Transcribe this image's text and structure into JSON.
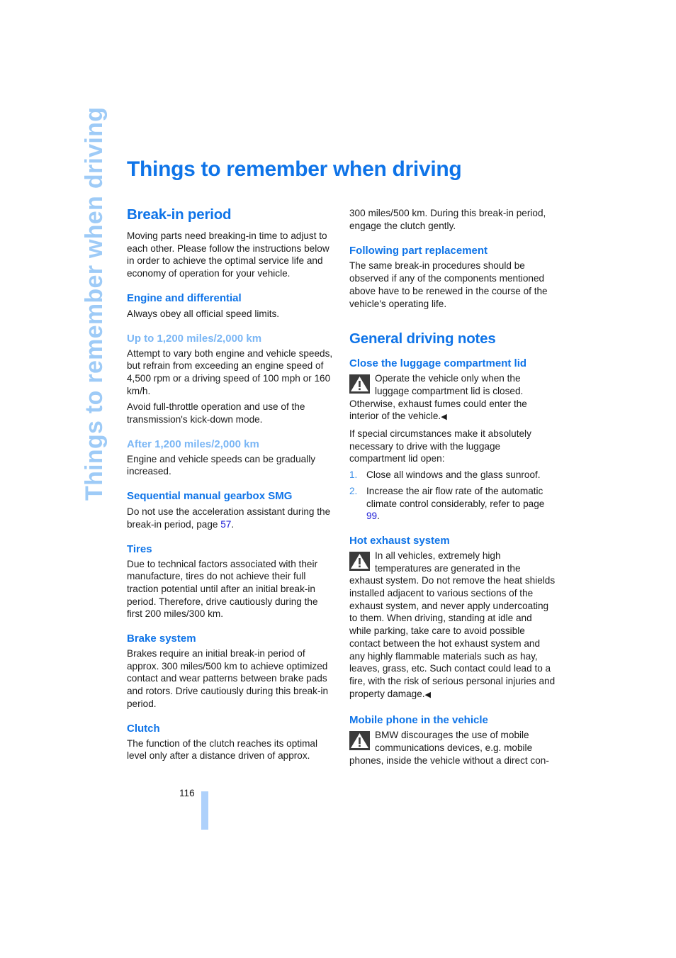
{
  "side_title": "Things to remember when driving",
  "page_title": "Things to remember when driving",
  "left_column": {
    "section_title": "Break-in period",
    "intro": "Moving parts need breaking-in time to adjust to each other. Please follow the instructions below in order to achieve the optimal service life and economy of operation for your vehicle.",
    "engine": {
      "heading": "Engine and differential",
      "text": "Always obey all official speed limits."
    },
    "up_to": {
      "heading": "Up to 1,200 miles/2,000 km",
      "text1": "Attempt to vary both engine and vehicle speeds, but refrain from exceeding an engine speed of 4,500 rpm or a driving speed of 100 mph or 160 km/h.",
      "text2": "Avoid full-throttle operation and use of the transmission's kick-down mode."
    },
    "after": {
      "heading": "After 1,200 miles/2,000 km",
      "text": "Engine and vehicle speeds can be gradually increased."
    },
    "smg": {
      "heading": "Sequential manual gearbox SMG",
      "text_before": "Do not use the acceleration assistant during the break-in period, page ",
      "link": "57",
      "text_after": "."
    },
    "tires": {
      "heading": "Tires",
      "text": "Due to technical factors associated with their manufacture, tires do not achieve their full traction potential until after an initial break-in period. Therefore, drive cautiously during the first 200 miles/300 km."
    },
    "brakes": {
      "heading": "Brake system",
      "text": "Brakes require an initial break-in period of approx. 300 miles/500 km to achieve optimized contact and wear patterns between brake pads and rotors. Drive cautiously during this break-in period."
    },
    "clutch": {
      "heading": "Clutch",
      "text": "The function of the clutch reaches its optimal level only after a distance driven of approx."
    }
  },
  "right_column": {
    "clutch_continued": "300 miles/500 km. During this break-in period, engage the clutch gently.",
    "part_replacement": {
      "heading": "Following part replacement",
      "text": "The same break-in procedures should be observed if any of the components mentioned above have to be renewed in the course of the vehicle's operating life."
    },
    "section_title": "General driving notes",
    "luggage": {
      "heading": "Close the luggage compartment lid",
      "warning_icon": "warning-triangle-icon",
      "warning": "Operate the vehicle only when the luggage compartment lid is closed. Otherwise, exhaust fumes could enter the interior of the vehicle.",
      "end_mark": "◀",
      "text": "If special circumstances make it absolutely necessary to drive with the luggage compartment lid open:",
      "steps": [
        {
          "num": "1.",
          "text": "Close all windows and the glass sunroof."
        },
        {
          "num": "2.",
          "text_before": "Increase the air flow rate of the automatic climate control considerably, refer to page ",
          "link": "99",
          "text_after": "."
        }
      ]
    },
    "exhaust": {
      "heading": "Hot exhaust system",
      "warning_icon": "warning-triangle-icon",
      "warning": "In all vehicles, extremely high temperatures are generated in the exhaust system. Do not remove the heat shields installed adjacent to various sections of the exhaust system, and never apply undercoating to them. When driving, standing at idle and while parking, take care to avoid possible contact between the hot exhaust system and any highly flammable materials such as hay, leaves, grass, etc. Such contact could lead to a fire, with the risk of serious personal injuries and property damage.",
      "end_mark": "◀"
    },
    "mobile": {
      "heading": "Mobile phone in the vehicle",
      "warning_icon": "warning-triangle-icon",
      "warning": "BMW discourages the use of mobile communications devices, e.g. mobile phones, inside the vehicle without a direct con-"
    }
  },
  "footer": {
    "page_number": "116"
  },
  "colors": {
    "heading_blue": "#0f74e8",
    "light_blue": "#7ab6f5",
    "side_title": "#9ecbf7",
    "link": "#1b1bd6",
    "page_bar": "#aed1fb"
  }
}
